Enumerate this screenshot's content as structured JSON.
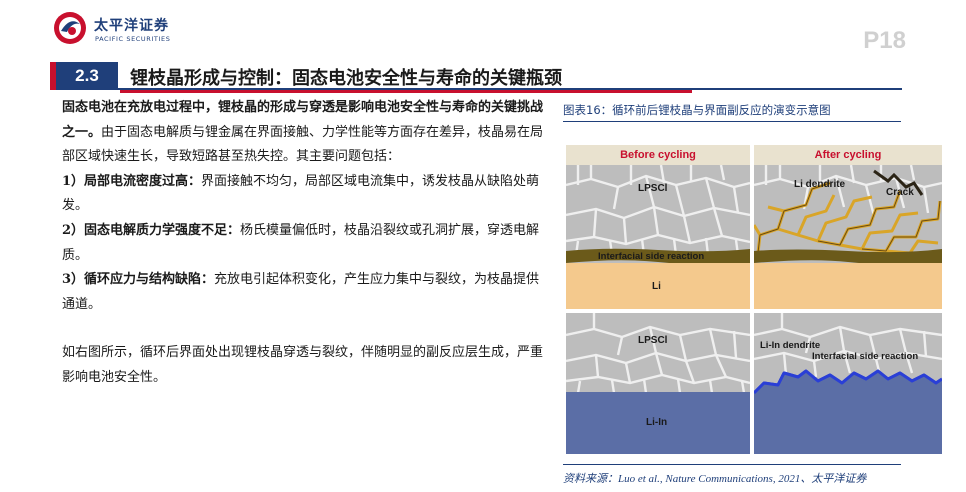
{
  "header": {
    "logo_cn": "太平洋证券",
    "logo_en": "PACIFIC SECURITIES",
    "page_number": "P18",
    "brand_color": "#1f3f7a",
    "accent_color": "#c8102e"
  },
  "section": {
    "number": "2.3",
    "title": "锂枝晶形成与控制：固态电池安全性与寿命的关键瓶颈"
  },
  "body": {
    "intro_bold": "固态电池在充放电过程中，锂枝晶的形成与穿透是影响电池安全性与寿命的关键挑战之一。",
    "intro_rest": "由于固态电解质与锂金属在界面接触、力学性能等方面存在差异，枝晶易在局部区域快速生长，导致短路甚至热失控。其主要问题包括：",
    "items": [
      {
        "bold": "1）局部电流密度过高：",
        "text": "界面接触不均匀，局部区域电流集中，诱发枝晶从缺陷处萌发。"
      },
      {
        "bold": "2）固态电解质力学强度不足：",
        "text": "杨氏模量偏低时，枝晶沿裂纹或孔洞扩展，穿透电解质。"
      },
      {
        "bold": "3）循环应力与结构缺陷：",
        "text": "充放电引起体积变化，产生应力集中与裂纹，为枝晶提供通道。"
      }
    ],
    "closing": "如右图所示，循环后界面处出现锂枝晶穿透与裂纹，伴随明显的副反应层生成，严重影响电池安全性。"
  },
  "figure": {
    "caption": "图表16：循环前后锂枝晶与界面副反应的演变示意图",
    "source": "资料来源：Luo et al., Nature Communications, 2021、太平洋证券",
    "head_before": "Before cycling",
    "head_after": "After cycling",
    "label_lpscl": "LPSCl",
    "label_interfacial": "Interfacial side reaction",
    "label_li": "Li",
    "label_li_dendrite": "Li dendrite",
    "label_crack": "Crack",
    "label_li_in_dendrite": "Li-In dendrite",
    "label_interfacial_2": "Interfacial side reaction",
    "label_li_in": "Li-In",
    "colors": {
      "electrolyte": "#bdbdbd",
      "grain_line": "#efefef",
      "interphase": "#6b5a1a",
      "lithium": "#f4c98d",
      "li_in": "#5b6ea6",
      "dendrite_gold": "#d9a528",
      "dendrite_blue": "#2a3fd6"
    }
  }
}
